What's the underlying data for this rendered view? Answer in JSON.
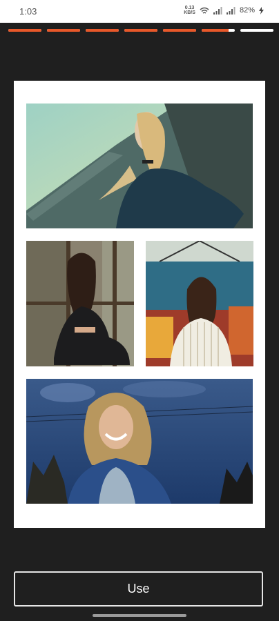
{
  "status_bar": {
    "time": "1:03",
    "network_speed_value": "0.13",
    "network_speed_unit": "KB/S",
    "battery": "82%",
    "icons": [
      "wifi-icon",
      "signal-icon",
      "signal-icon",
      "battery-charging-icon"
    ]
  },
  "progress": {
    "segments": [
      1,
      1,
      1,
      1,
      1,
      0.82,
      0
    ],
    "accent_color": "#e8582a",
    "track_color": "#ffffff"
  },
  "collage": {
    "photos": [
      {
        "subject": "woman-leaning-on-wall"
      },
      {
        "subject": "woman-sitting-by-window"
      },
      {
        "subject": "woman-at-carnival"
      },
      {
        "subject": "woman-smiling-denim-jacket"
      }
    ]
  },
  "actions": {
    "use_label": "Use"
  }
}
